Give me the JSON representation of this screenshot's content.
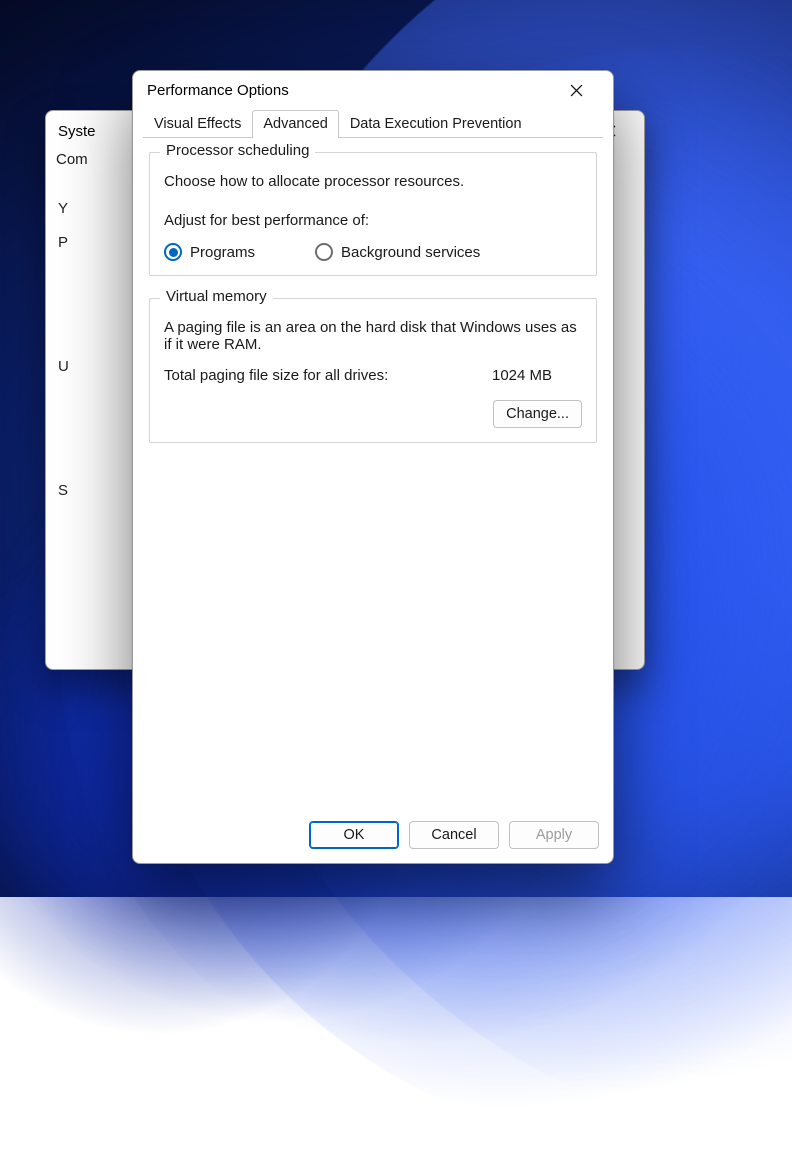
{
  "bgWindow": {
    "title": "Syste",
    "tabsFragment": "Com",
    "rowY": "Y",
    "rowP": "P",
    "rowU": "U",
    "rowS": "S"
  },
  "dialog": {
    "title": "Performance Options",
    "tabs": {
      "visual": "Visual Effects",
      "advanced": "Advanced",
      "dep": "Data Execution Prevention"
    },
    "processor": {
      "legend": "Processor scheduling",
      "desc": "Choose how to allocate processor resources.",
      "adjust": "Adjust for best performance of:",
      "optPrograms": "Programs",
      "optBackground": "Background services",
      "selected": "programs"
    },
    "vm": {
      "legend": "Virtual memory",
      "desc": "A paging file is an area on the hard disk that Windows uses as if it were RAM.",
      "totalLabel": "Total paging file size for all drives:",
      "totalValue": "1024 MB",
      "changeBtn": "Change..."
    },
    "buttons": {
      "ok": "OK",
      "cancel": "Cancel",
      "apply": "Apply"
    }
  }
}
